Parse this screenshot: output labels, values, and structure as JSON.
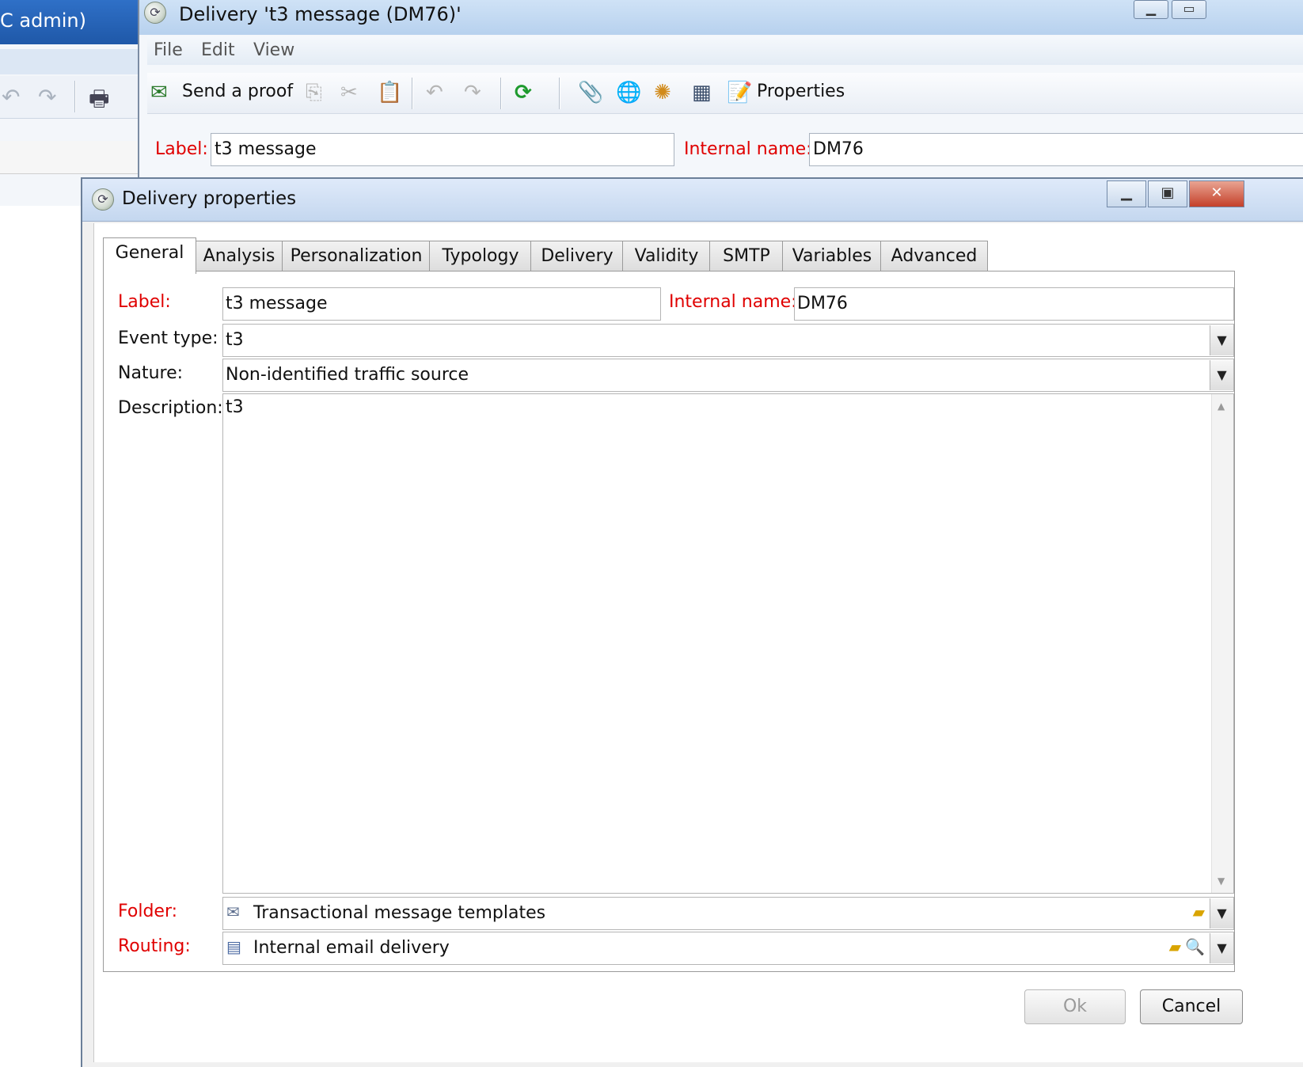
{
  "background_window": {
    "title_fragment": "C admin)"
  },
  "delivery_window": {
    "title": "Delivery 't3 message (DM76)'",
    "menu": [
      "File",
      "Edit",
      "View"
    ],
    "toolbar": {
      "send_proof_label": "Send a proof",
      "properties_label": "Properties"
    },
    "label_caption": "Label:",
    "label_value": "t3 message",
    "internal_name_caption": "Internal name:",
    "internal_name_value": "DM76"
  },
  "dialog": {
    "title": "Delivery properties",
    "tabs": [
      "General",
      "Analysis",
      "Personalization",
      "Typology",
      "Delivery",
      "Validity",
      "SMTP",
      "Variables",
      "Advanced"
    ],
    "active_tab": "General",
    "fields": {
      "label_caption": "Label:",
      "label_value": "t3 message",
      "internal_name_caption": "Internal name:",
      "internal_name_value": "DM76",
      "event_type_caption": "Event type:",
      "event_type_value": "t3",
      "nature_caption": "Nature:",
      "nature_value": "Non-identified traffic source",
      "description_caption": "Description:",
      "description_value": "t3",
      "folder_caption": "Folder:",
      "folder_value": "Transactional message templates",
      "routing_caption": "Routing:",
      "routing_value": "Internal email delivery"
    },
    "buttons": {
      "ok": "Ok",
      "cancel": "Cancel"
    }
  },
  "colors": {
    "required_label": "#e00000",
    "titlebar_active": "#2f70c7",
    "close_button": "#c4402a"
  }
}
